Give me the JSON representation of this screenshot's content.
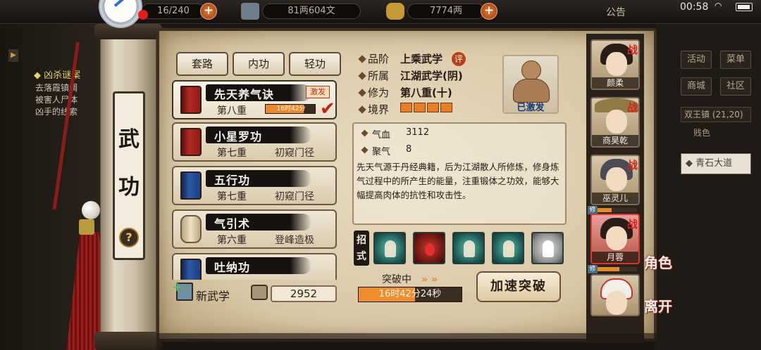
{
  "topbar": {
    "stamina": "16/240",
    "silver": "81两604文",
    "gold": "7774两",
    "notice": "公告",
    "clock": "00:58"
  },
  "left_panel": {
    "quest_title": "凶杀谜案",
    "quest_lines": [
      "去落霞镇调",
      "被害人尸体",
      "凶手的线索"
    ]
  },
  "right_panel": {
    "buttons": [
      "活动",
      "菜单",
      "商城",
      "社区"
    ],
    "location": "双王镇 (21,20)",
    "location_tag": "贱色",
    "road": "青石大道"
  },
  "page_title": [
    "武",
    "功"
  ],
  "tabs": [
    "套路",
    "内功",
    "轻功"
  ],
  "skills": [
    {
      "name": "先天养气诀",
      "level": "第八重",
      "rank": "",
      "badge": "激发",
      "timer": "16时42分",
      "timer_progress": 0.75,
      "book": "red"
    },
    {
      "name": "小星罗功",
      "level": "第七重",
      "rank": "初窥门径",
      "book": "red"
    },
    {
      "name": "五行功",
      "level": "第七重",
      "rank": "初窥门径",
      "book": "blue"
    },
    {
      "name": "气引术",
      "level": "第六重",
      "rank": "登峰造极",
      "book": "scroll"
    },
    {
      "name": "吐纳功",
      "level": "",
      "rank": "",
      "book": "blue"
    }
  ],
  "new_skill_label": "新武学",
  "skill_points": "2952",
  "info": {
    "grade_label": "品阶",
    "grade_value": "上乘武学",
    "eval_badge": "评",
    "faction_label": "所属",
    "faction_value": "江湖武学(阴)",
    "cultivation_label": "修为",
    "cultivation_value": "第八重(十)",
    "realm_label": "境界",
    "realm_filled": 4,
    "realm_total": 4
  },
  "portrait_status": "已激发",
  "stats": [
    {
      "label": "气血",
      "value": "3112"
    },
    {
      "label": "聚气",
      "value": "8"
    }
  ],
  "description": "先天气源于丹经典籍，后为江湖散人所修炼，修身炼气过程中的所产生的能量，注重锻体之功效，能够大幅提高肉体的抗性和攻击性。",
  "moves_label": [
    "招",
    "式"
  ],
  "moves": [
    {
      "icon": "teal-figure-icon"
    },
    {
      "icon": "blood-drop-icon"
    },
    {
      "icon": "meditate-figure-icon"
    },
    {
      "icon": "teal-aura-icon"
    },
    {
      "icon": "grey-figure-icon"
    }
  ],
  "breakthrough": {
    "label": "突破中",
    "timer": "16时42分24秒",
    "progress": 0.55,
    "speed_button": "加速突破"
  },
  "characters": [
    {
      "name": "颜柔",
      "battle": "战",
      "selected": false,
      "cultivate": false
    },
    {
      "name": "商昊乾",
      "battle": "战",
      "selected": false,
      "cultivate": false
    },
    {
      "name": "巫灵儿",
      "battle": "战",
      "selected": false,
      "cultivate": true,
      "progress": 0.35
    },
    {
      "name": "月蓉",
      "battle": "战",
      "selected": true,
      "cultivate": true,
      "progress": 0.55
    },
    {
      "name": "",
      "battle": "",
      "selected": false,
      "cultivate": false
    }
  ],
  "cultivate_tag": "修",
  "side_labels": {
    "role": "角色",
    "leave": "离开"
  },
  "colors": {
    "accent_orange": "#e67e27",
    "battle_red": "#d6231b",
    "parchment": "#e2d3b4"
  }
}
